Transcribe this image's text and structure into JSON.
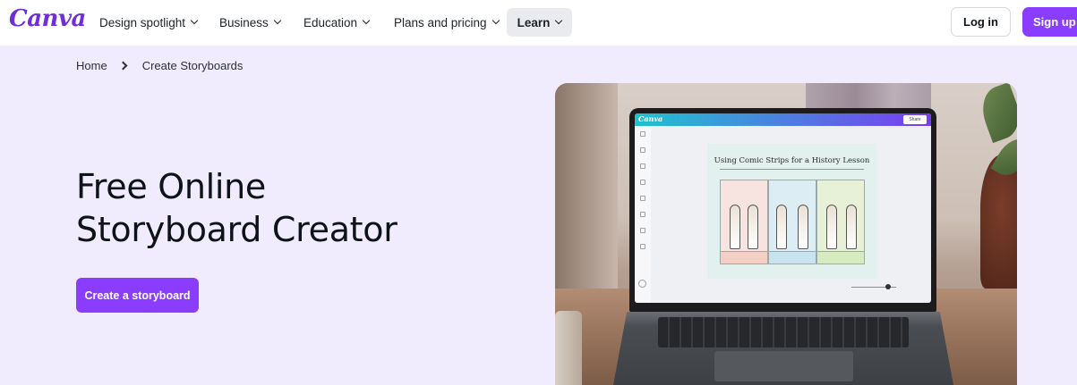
{
  "brand": {
    "logo_text": "Canva",
    "accent": "#8b3dff",
    "hero_bg": "#f0ecfd"
  },
  "nav": {
    "items": [
      {
        "label": "Design spotlight",
        "has_dropdown": true
      },
      {
        "label": "Business",
        "has_dropdown": true
      },
      {
        "label": "Education",
        "has_dropdown": true
      },
      {
        "label": "Plans and pricing",
        "has_dropdown": true
      },
      {
        "label": "Learn",
        "has_dropdown": true,
        "active": true
      }
    ],
    "login_label": "Log in",
    "signup_label": "Sign up"
  },
  "breadcrumb": {
    "home": "Home",
    "current": "Create Storyboards"
  },
  "hero": {
    "title_line1": "Free Online",
    "title_line2": "Storyboard Creator",
    "cta_label": "Create a storyboard"
  },
  "hero_image": {
    "screen_doc_title": "Using Comic Strips for a History Lesson",
    "screen_logo": "Canva",
    "screen_share": "Share"
  }
}
